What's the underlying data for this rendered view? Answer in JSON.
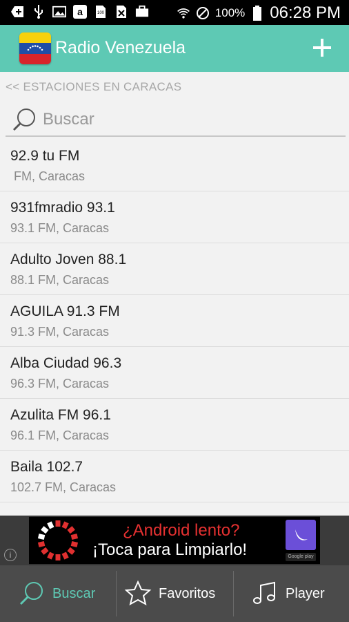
{
  "status_bar": {
    "battery": "100%",
    "time": "06:28 PM"
  },
  "app_bar": {
    "title": "Radio Venezuela",
    "add_icon": "plus-icon"
  },
  "breadcrumb": "<< ESTACIONES EN CARACAS",
  "search": {
    "placeholder": "Buscar",
    "value": ""
  },
  "stations": [
    {
      "name": "92.9 tu FM",
      "subtitle": " FM, Caracas"
    },
    {
      "name": "931fmradio 93.1",
      "subtitle": "93.1 FM, Caracas"
    },
    {
      "name": "Adulto Joven 88.1",
      "subtitle": "88.1 FM, Caracas"
    },
    {
      "name": "AGUILA 91.3 FM",
      "subtitle": "91.3 FM, Caracas"
    },
    {
      "name": "Alba Ciudad 96.3",
      "subtitle": "96.3 FM, Caracas"
    },
    {
      "name": "Azulita FM 96.1",
      "subtitle": "96.1 FM, Caracas"
    },
    {
      "name": "Baila 102.7",
      "subtitle": "102.7 FM, Caracas"
    }
  ],
  "ad": {
    "line1": "¿Android lento?",
    "line2": "¡Toca para Limpiarlo!",
    "badge": "Google play"
  },
  "bottom_nav": [
    {
      "label": "Buscar",
      "icon": "search-icon",
      "active": true
    },
    {
      "label": "Favoritos",
      "icon": "star-icon",
      "active": false
    },
    {
      "label": "Player",
      "icon": "music-note-icon",
      "active": false
    }
  ],
  "colors": {
    "accent": "#5ec9b4",
    "nav_bg": "#4b4b4b",
    "ad_red": "#e63131"
  }
}
